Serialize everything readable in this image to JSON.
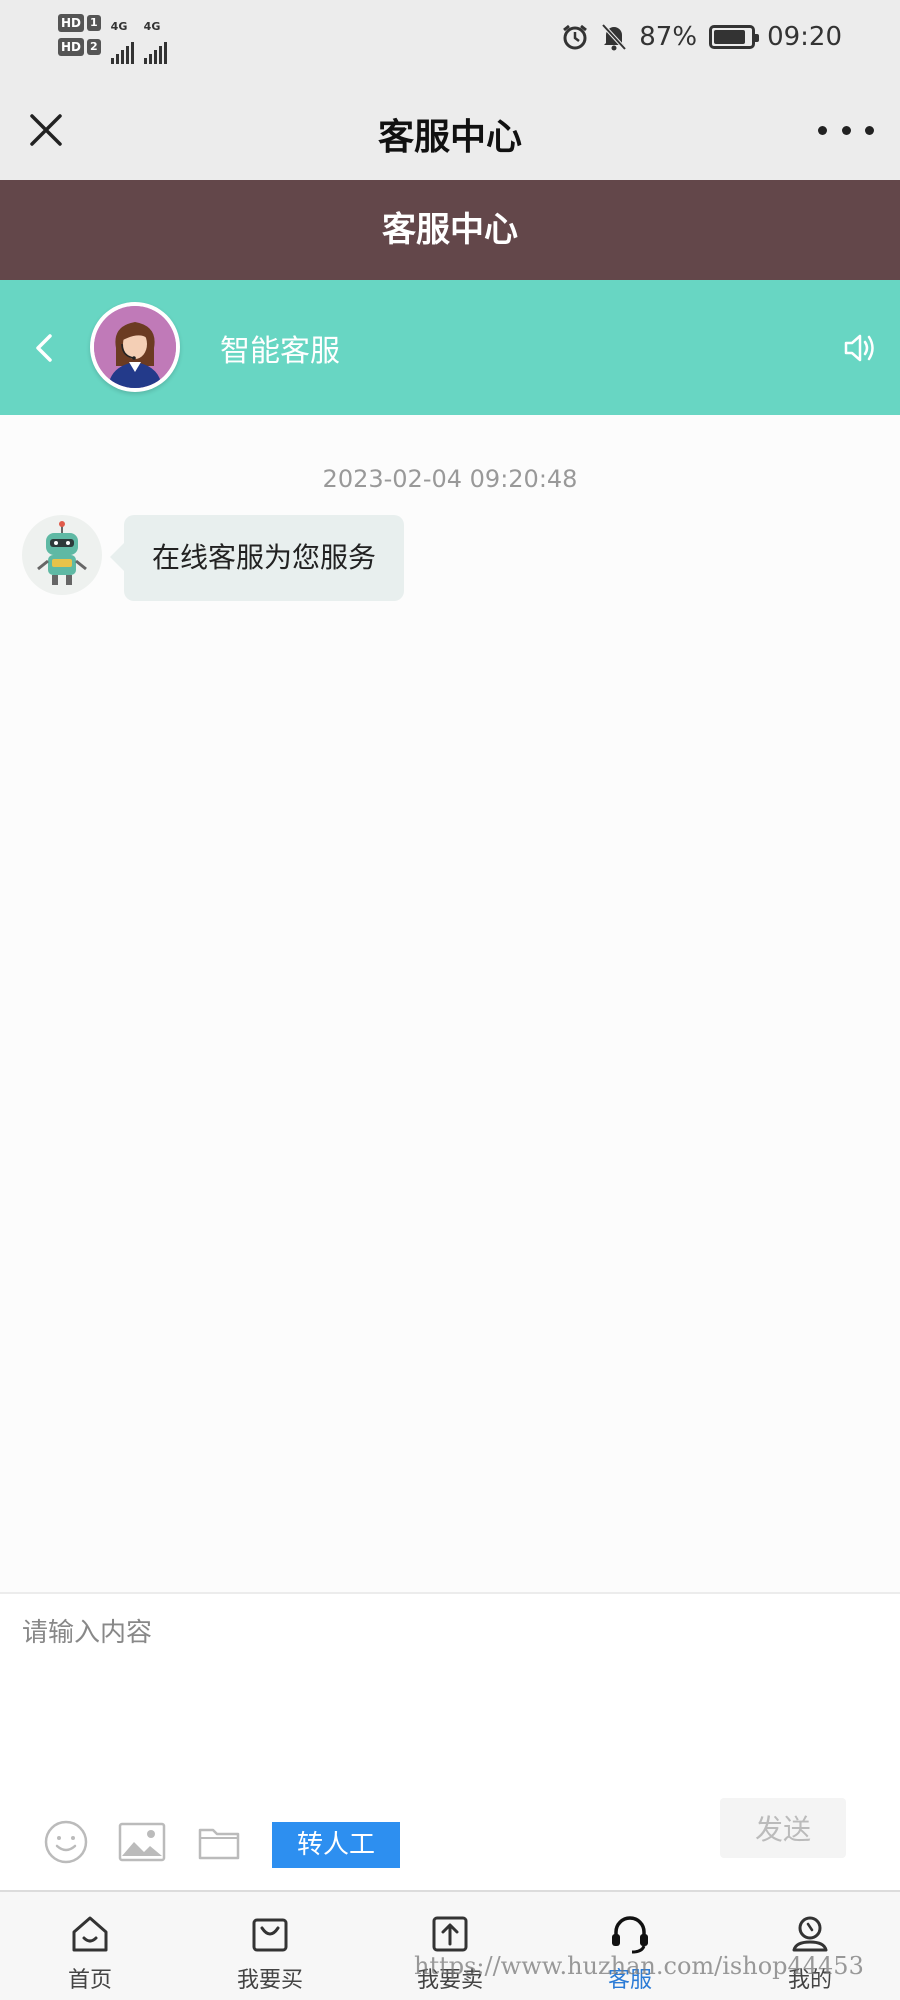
{
  "status_bar": {
    "sim1_label": "HD",
    "sim1_num": "1",
    "sim2_label": "HD",
    "sim2_num": "2",
    "network1": "4G",
    "network2": "4G",
    "battery_percent": "87%",
    "battery_level": 0.87,
    "time": "09:20",
    "icons": [
      "alarm-icon",
      "mute-bell-icon",
      "battery-icon"
    ]
  },
  "title_bar": {
    "title": "客服中心",
    "close_icon": "close-icon",
    "more_icon": "more-dots-icon"
  },
  "header": {
    "title": "客服中心"
  },
  "chat_header": {
    "agent_name": "智能客服",
    "back_icon": "chevron-left-icon",
    "sound_icon": "speaker-icon"
  },
  "chat": {
    "timestamp": "2023-02-04 09:20:48",
    "messages": [
      {
        "sender": "bot",
        "text": "在线客服为您服务"
      }
    ]
  },
  "input": {
    "placeholder": "请输入内容",
    "value": "",
    "send_label": "发送",
    "transfer_label": "转人工",
    "tools": [
      "emoji-icon",
      "image-icon",
      "folder-icon"
    ]
  },
  "bottom_nav": {
    "items": [
      {
        "label": "首页",
        "icon": "home-icon",
        "active": false
      },
      {
        "label": "我要买",
        "icon": "shopping-bag-icon",
        "active": false
      },
      {
        "label": "我要卖",
        "icon": "upload-icon",
        "active": false
      },
      {
        "label": "客服",
        "icon": "headset-icon",
        "active": true
      },
      {
        "label": "我的",
        "icon": "user-icon",
        "active": false
      }
    ]
  },
  "colors": {
    "header_brown": "#63474a",
    "chat_header_teal": "#68d6c3",
    "transfer_blue": "#2d8ff0",
    "active_nav": "#2b7bd6"
  },
  "watermark": "https://www.huzhan.com/ishop44453"
}
